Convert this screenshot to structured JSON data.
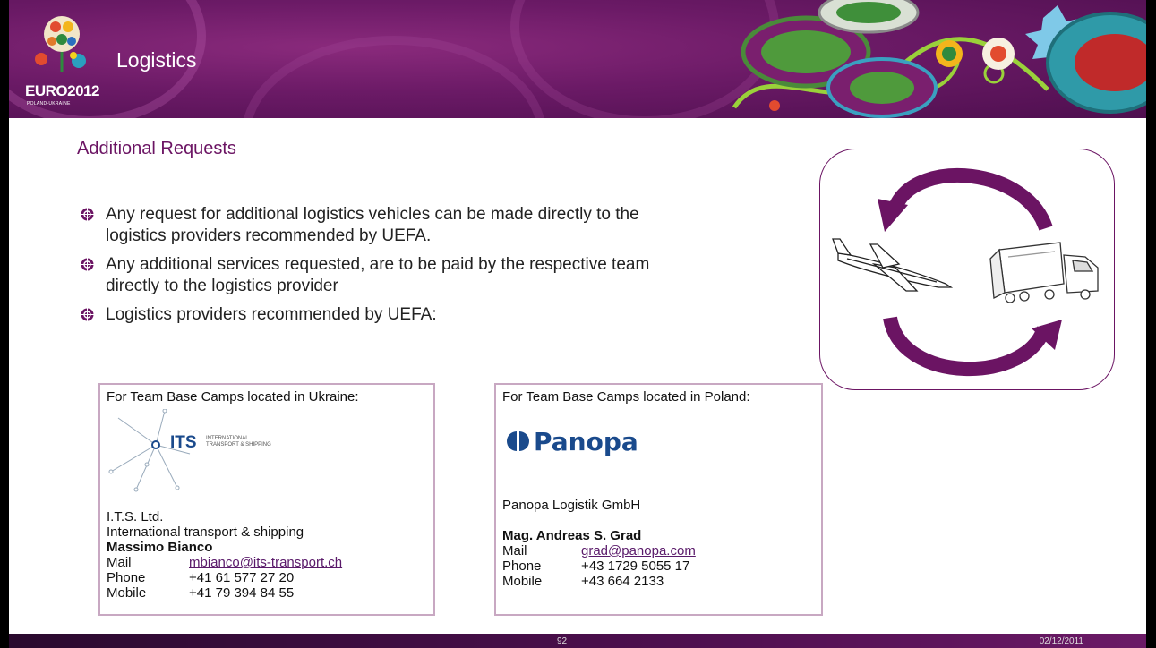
{
  "header": {
    "title": "Logistics",
    "logo_text": "EURO2012",
    "logo_sub": "POLAND-UKRAINE"
  },
  "subtitle": "Additional Requests",
  "bullets": [
    "Any request for additional logistics vehicles can be made directly to the logistics providers recommended by UEFA.",
    "Any additional services requested, are to be paid by the respective team directly to the logistics provider",
    "Logistics providers recommended by UEFA:"
  ],
  "ukraine": {
    "heading": "For Team Base Camps located in Ukraine:",
    "logo_brand": "ITS",
    "logo_tagline_1": "INTERNATIONAL",
    "logo_tagline_2": "TRANSPORT & SHIPPING",
    "company": "I.T.S. Ltd.",
    "company_desc": "International transport & shipping",
    "contact_name": "Massimo Bianco",
    "mail_label": "Mail",
    "mail": "mbianco@its-transport.ch",
    "phone_label": "Phone",
    "phone": "+41 61 577 27 20",
    "mobile_label": "Mobile",
    "mobile": "+41 79 394 84 55"
  },
  "poland": {
    "heading": "For Team Base Camps located in Poland:",
    "logo_brand": "Panopa",
    "company": "Panopa Logistik GmbH",
    "contact_name": "Mag. Andreas S. Grad",
    "mail_label": "Mail",
    "mail": "grad@panopa.com",
    "phone_label": "Phone",
    "phone": "+43 1729 5055 17",
    "mobile_label": "Mobile",
    "mobile": "+43 664 2133"
  },
  "footer": {
    "page_number": "92",
    "date": "02/12/2011"
  },
  "colors": {
    "brand_purple": "#6b1463",
    "header_bg": "#6b1a66",
    "link": "#5a1a6a"
  }
}
